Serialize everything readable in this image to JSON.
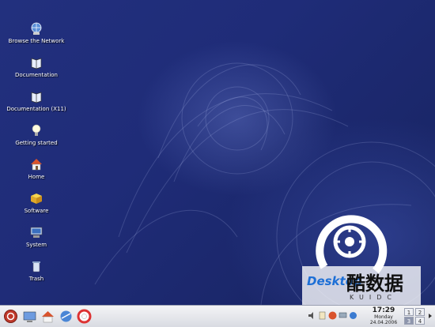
{
  "desktop": {
    "icons": [
      {
        "label": "Browse the Network",
        "icon": "network-globe-icon"
      },
      {
        "label": "Documentation",
        "icon": "documentation-book-icon"
      },
      {
        "label": "Documentation (X11)",
        "icon": "documentation-x11-icon"
      },
      {
        "label": "Getting started",
        "icon": "lightbulb-icon"
      },
      {
        "label": "Home",
        "icon": "home-icon"
      },
      {
        "label": "Software",
        "icon": "software-box-icon"
      },
      {
        "label": "System",
        "icon": "system-computer-icon"
      },
      {
        "label": "Trash",
        "icon": "trash-icon"
      }
    ]
  },
  "watermark": {
    "brand": "Desktop",
    "chinese": "酷数据",
    "sub": "KUIDC"
  },
  "taskbar": {
    "launchers": [
      "start-menu-icon",
      "desktop-icon",
      "home-icon",
      "network-icon",
      "help-lifebuoy-icon"
    ],
    "tray": [
      "volume-icon",
      "clipboard-icon",
      "suse-updater-icon",
      "monitor-icon",
      "network-status-icon"
    ],
    "clock": {
      "time": "17:29",
      "day": "Monday",
      "date": "24.04.2006"
    },
    "pager": [
      "1",
      "2",
      "3",
      "4"
    ]
  },
  "colors": {
    "desktop_bg": "#1f2c78",
    "taskbar_bg": "#e4e6ec",
    "accent": "#1d6fd6"
  }
}
